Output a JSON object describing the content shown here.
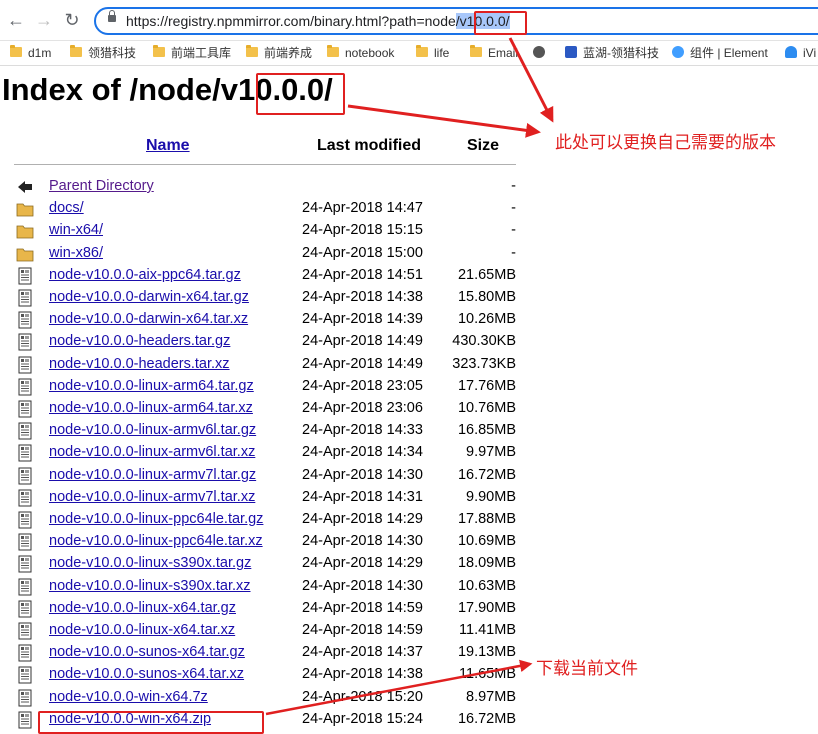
{
  "browser": {
    "back_label": "←",
    "forward_label": "→",
    "reload_label": "↻",
    "url_prefix": "https://registry.npmmirror.com/binary.html?path=node",
    "url_selected": "/v10.0.0/",
    "bookmarks": [
      {
        "label": "d1m",
        "icon": "folder-icon"
      },
      {
        "label": "领猎科技",
        "icon": "folder-icon"
      },
      {
        "label": "前端工具库",
        "icon": "folder-icon"
      },
      {
        "label": "前端养成",
        "icon": "folder-icon"
      },
      {
        "label": "notebook",
        "icon": "folder-icon"
      },
      {
        "label": "life",
        "icon": "folder-icon"
      },
      {
        "label": "Email",
        "icon": "folder-icon"
      },
      {
        "label": "",
        "icon": "globe-icon"
      },
      {
        "label": "蓝湖-领猎科技",
        "icon": "lanhu-icon"
      },
      {
        "label": "组件 | Element",
        "icon": "element-icon"
      },
      {
        "label": "iVi",
        "icon": "iview-icon"
      }
    ]
  },
  "page": {
    "title_prefix": "Index of /node/v",
    "title_version": "10.0.0",
    "title_suffix": "/"
  },
  "table": {
    "headers": {
      "name": "Name",
      "modified": "Last modified",
      "size": "Size"
    },
    "rows": [
      {
        "name": "Parent Directory",
        "date": "",
        "size": "-",
        "icon": "back-icon"
      },
      {
        "name": "docs/",
        "date": "24-Apr-2018 14:47",
        "size": "-",
        "icon": "folder-icon"
      },
      {
        "name": "win-x64/",
        "date": "24-Apr-2018 15:15",
        "size": "-",
        "icon": "folder-icon"
      },
      {
        "name": "win-x86/",
        "date": "24-Apr-2018 15:00",
        "size": "-",
        "icon": "folder-icon"
      },
      {
        "name": "node-v10.0.0-aix-ppc64.tar.gz",
        "date": "24-Apr-2018 14:51",
        "size": "21.65MB",
        "icon": "file-icon"
      },
      {
        "name": "node-v10.0.0-darwin-x64.tar.gz",
        "date": "24-Apr-2018 14:38",
        "size": "15.80MB",
        "icon": "file-icon"
      },
      {
        "name": "node-v10.0.0-darwin-x64.tar.xz",
        "date": "24-Apr-2018 14:39",
        "size": "10.26MB",
        "icon": "file-icon"
      },
      {
        "name": "node-v10.0.0-headers.tar.gz",
        "date": "24-Apr-2018 14:49",
        "size": "430.30KB",
        "icon": "file-icon"
      },
      {
        "name": "node-v10.0.0-headers.tar.xz",
        "date": "24-Apr-2018 14:49",
        "size": "323.73KB",
        "icon": "file-icon"
      },
      {
        "name": "node-v10.0.0-linux-arm64.tar.gz",
        "date": "24-Apr-2018 23:05",
        "size": "17.76MB",
        "icon": "file-icon"
      },
      {
        "name": "node-v10.0.0-linux-arm64.tar.xz",
        "date": "24-Apr-2018 23:06",
        "size": "10.76MB",
        "icon": "file-icon"
      },
      {
        "name": "node-v10.0.0-linux-armv6l.tar.gz",
        "date": "24-Apr-2018 14:33",
        "size": "16.85MB",
        "icon": "file-icon"
      },
      {
        "name": "node-v10.0.0-linux-armv6l.tar.xz",
        "date": "24-Apr-2018 14:34",
        "size": "9.97MB",
        "icon": "file-icon"
      },
      {
        "name": "node-v10.0.0-linux-armv7l.tar.gz",
        "date": "24-Apr-2018 14:30",
        "size": "16.72MB",
        "icon": "file-icon"
      },
      {
        "name": "node-v10.0.0-linux-armv7l.tar.xz",
        "date": "24-Apr-2018 14:31",
        "size": "9.90MB",
        "icon": "file-icon"
      },
      {
        "name": "node-v10.0.0-linux-ppc64le.tar.gz",
        "date": "24-Apr-2018 14:29",
        "size": "17.88MB",
        "icon": "file-icon"
      },
      {
        "name": "node-v10.0.0-linux-ppc64le.tar.xz",
        "date": "24-Apr-2018 14:30",
        "size": "10.69MB",
        "icon": "file-icon"
      },
      {
        "name": "node-v10.0.0-linux-s390x.tar.gz",
        "date": "24-Apr-2018 14:29",
        "size": "18.09MB",
        "icon": "file-icon"
      },
      {
        "name": "node-v10.0.0-linux-s390x.tar.xz",
        "date": "24-Apr-2018 14:30",
        "size": "10.63MB",
        "icon": "file-icon"
      },
      {
        "name": "node-v10.0.0-linux-x64.tar.gz",
        "date": "24-Apr-2018 14:59",
        "size": "17.90MB",
        "icon": "file-icon"
      },
      {
        "name": "node-v10.0.0-linux-x64.tar.xz",
        "date": "24-Apr-2018 14:59",
        "size": "11.41MB",
        "icon": "file-icon"
      },
      {
        "name": "node-v10.0.0-sunos-x64.tar.gz",
        "date": "24-Apr-2018 14:37",
        "size": "19.13MB",
        "icon": "file-icon"
      },
      {
        "name": "node-v10.0.0-sunos-x64.tar.xz",
        "date": "24-Apr-2018 14:38",
        "size": "11.65MB",
        "icon": "file-icon"
      },
      {
        "name": "node-v10.0.0-win-x64.7z",
        "date": "24-Apr-2018 15:20",
        "size": "8.97MB",
        "icon": "file-icon"
      },
      {
        "name": "node-v10.0.0-win-x64.zip",
        "date": "24-Apr-2018 15:24",
        "size": "16.72MB",
        "icon": "file-icon"
      }
    ]
  },
  "annotations": {
    "version_note": "此处可以更换自己需要的版本",
    "download_note": "下载当前文件"
  },
  "colors": {
    "annotation": "#e02020",
    "link": "#1a0dab",
    "visited_link": "#551a8b",
    "omnibox_focus": "#1a73e8",
    "url_selection": "#a8c7fa"
  }
}
